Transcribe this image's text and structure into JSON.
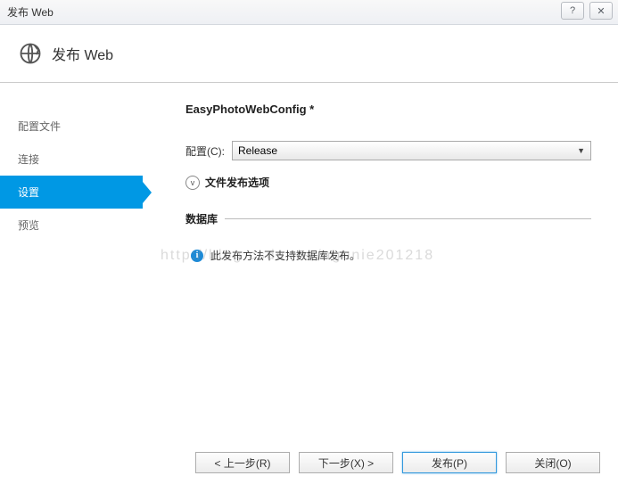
{
  "titlebar": {
    "title": "发布 Web",
    "help": "?",
    "close": "✕"
  },
  "header": {
    "title": "发布 Web"
  },
  "sidebar": {
    "items": [
      {
        "label": "配置文件"
      },
      {
        "label": "连接"
      },
      {
        "label": "设置"
      },
      {
        "label": "预览"
      }
    ]
  },
  "main": {
    "profile_title": "EasyPhotoWebConfig *",
    "config_label": "配置(C):",
    "config_value": "Release",
    "expander_label": "文件发布选项",
    "db_section": "数据库",
    "db_info": "此发布方法不支持数据库发布。"
  },
  "footer": {
    "prev": "< 上一步(R)",
    "next": "下一步(X) >",
    "publish": "发布(P)",
    "close": "关闭(O)"
  },
  "watermark": "http://blog.csdn.net/agonie201218"
}
